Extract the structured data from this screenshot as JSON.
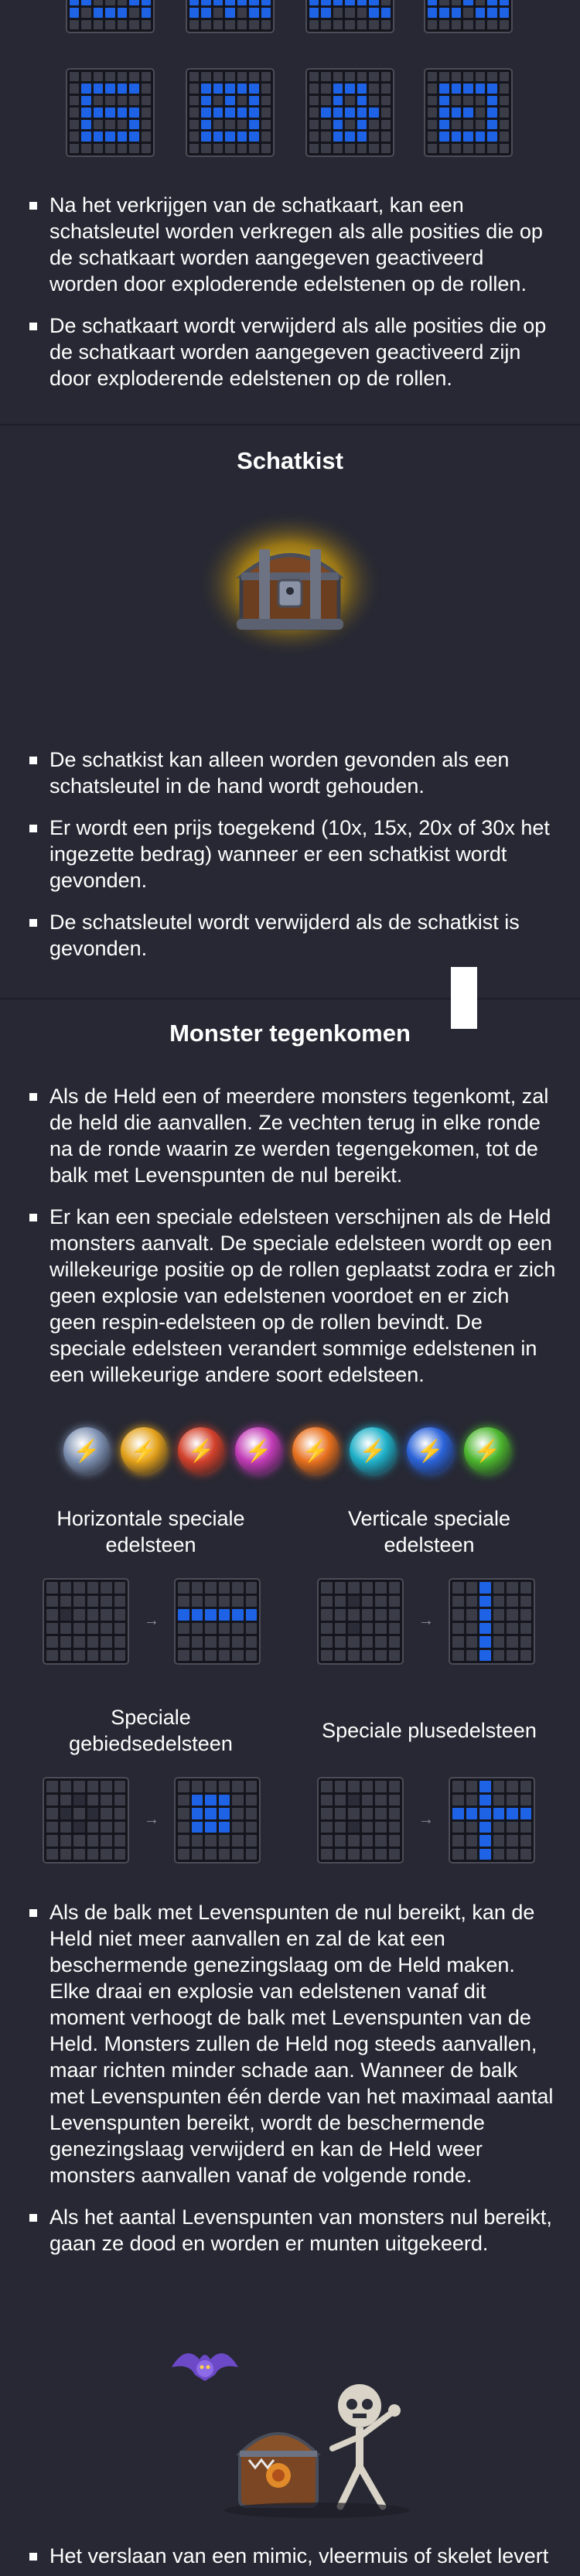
{
  "treasure_map": {
    "bullets": [
      "Na het verkrijgen van de schatkaart, kan een schatsleutel worden verkregen als alle posities die op de schatkaart worden aangegeven geactiveerd worden door exploderende edelstenen op de rollen.",
      "De schatkaart wordt verwijderd als alle posities die op de schatkaart worden aangegeven geactiveerd zijn door exploderende edelstenen op de rollen."
    ]
  },
  "treasure_chest": {
    "title": "Schatkist",
    "image_icon": "treasure-chest-icon",
    "bullets": [
      "De schatkist kan alleen worden gevonden als een schatsleutel in de hand wordt gehouden.",
      "Er wordt een prijs toegekend (10x, 15x, 20x of 30x het ingezette bedrag) wanneer er een schatkist wordt gevonden.",
      "De schatsleutel wordt verwijderd als de schatkist is gevonden."
    ]
  },
  "monsters": {
    "title": "Monster tegenkomen",
    "bullets_top": [
      "Als de Held een of meerdere monsters tegenkomt, zal de held die aanvallen. Ze vechten terug in elke ronde na de ronde waarin ze werden tegengekomen, tot de balk met Levenspunten de nul bereikt.",
      "Er kan een speciale edelsteen verschijnen als de Held monsters aanvalt. De speciale edelsteen wordt op een willekeurige positie op de rollen geplaatst zodra er zich geen explosie van edelstenen voordoet en er zich geen respin-edelsteen op de rollen bevindt. De speciale edelsteen verandert sommige edelstenen in een willekeurige andere soort edelsteen."
    ],
    "special_gems": [
      {
        "icon": "blue-lightning-gem-icon",
        "color": "#7c8fb0"
      },
      {
        "icon": "yellow-lightning-gem-icon",
        "color": "#e3a11a"
      },
      {
        "icon": "red-lightning-gem-icon",
        "color": "#d2402a"
      },
      {
        "icon": "pink-lightning-gem-icon",
        "color": "#c23bb6"
      },
      {
        "icon": "orange-lightning-gem-icon",
        "color": "#e8701d"
      },
      {
        "icon": "cyan-lightning-gem-icon",
        "color": "#1fb0c8"
      },
      {
        "icon": "deep-blue-lightning-gem-icon",
        "color": "#2b63d9"
      },
      {
        "icon": "green-lightning-gem-icon",
        "color": "#4bb52d"
      }
    ],
    "labels": {
      "horizontal": "Horizontale speciale edelsteen",
      "vertical": "Verticale speciale edelsteen",
      "area": "Speciale gebiedsedelsteen",
      "plus": "Speciale plusedelsteen"
    },
    "arrow_glyph": "→",
    "bullets_bottom": [
      "Als de balk met Levenspunten de nul bereikt, kan de Held niet meer aanvallen en zal de kat een beschermende genezingslaag om de Held maken. Elke draai en explosie van edelstenen vanaf dit moment verhoogt de balk met Levenspunten van de Held. Monsters zullen de Held nog steeds aanvallen, maar richten minder schade aan. Wanneer de balk met Levenspunten één derde van het maximaal aantal Levenspunten bereikt, wordt de beschermende genezingslaag verwijderd en kan de Held weer monsters aanvallen vanaf de volgende ronde.",
      "Als het aantal Levenspunten van monsters nul bereikt, gaan ze dood en worden er munten uitgekeerd."
    ],
    "monster_icons": [
      "bat-icon",
      "mimic-chest-icon",
      "skeleton-icon"
    ],
    "last_bullet": "Het verslaan van een mimic, vleermuis of skelet levert"
  },
  "colors": {
    "background": "#272833",
    "active_cell": "#1e63e6",
    "cell": "#3a3c47"
  }
}
